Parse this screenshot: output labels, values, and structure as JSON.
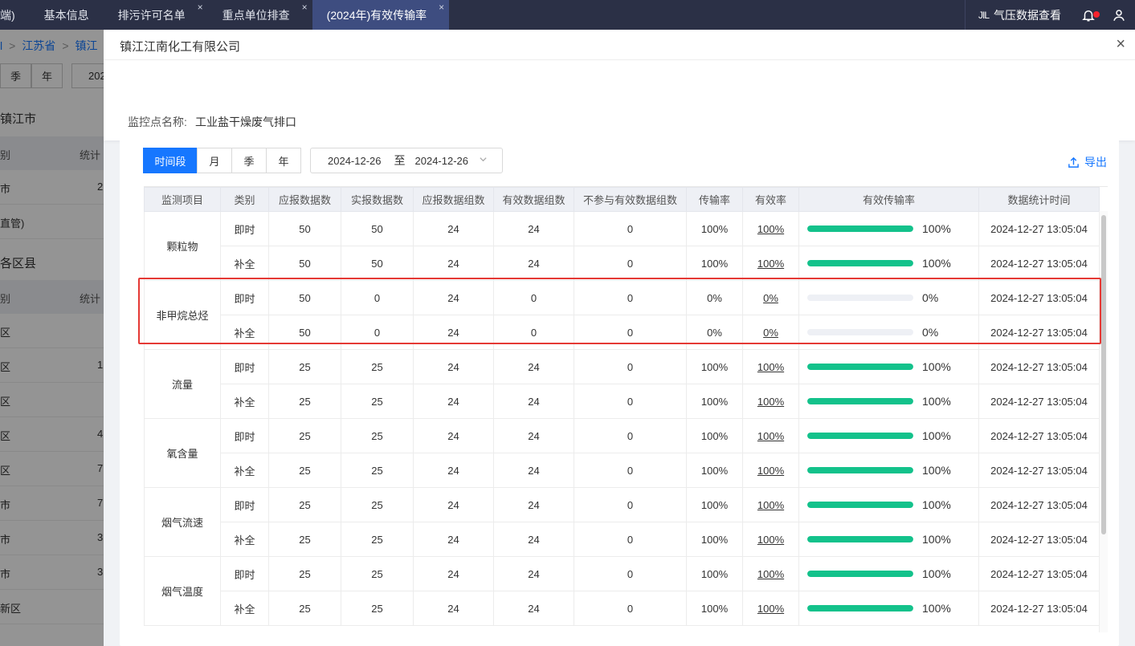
{
  "topbar": {
    "tabs": [
      {
        "label": "端)",
        "active": false,
        "closable": false
      },
      {
        "label": "基本信息",
        "active": false,
        "closable": false
      },
      {
        "label": "排污许可名单",
        "active": false,
        "closable": true
      },
      {
        "label": "重点单位排查",
        "active": false,
        "closable": true
      },
      {
        "label": "(2024年)有效传输率",
        "active": true,
        "closable": true
      }
    ],
    "close_glyph": "×",
    "pressure_icon_text": "JIL",
    "pressure_label": "气压数据查看",
    "bell_icon": "bell-icon",
    "user_icon": "user-icon"
  },
  "background": {
    "breadcrumb": [
      "l",
      ">",
      "江苏省",
      ">",
      "镇江"
    ],
    "seg": [
      "季",
      "年"
    ],
    "date": "202",
    "section1": "镇江市",
    "head1": {
      "c1": "别",
      "c2": "统计"
    },
    "rows1": [
      {
        "c1": "市",
        "c2": "2"
      },
      {
        "c1": "直管)",
        "c2": ""
      }
    ],
    "section2": "各区县",
    "head2": {
      "c1": "别",
      "c2": "统计"
    },
    "rows2": [
      {
        "c1": "区",
        "c2": ""
      },
      {
        "c1": "区",
        "c2": "1"
      },
      {
        "c1": "区",
        "c2": ""
      },
      {
        "c1": "区",
        "c2": "4"
      },
      {
        "c1": "区",
        "c2": "7"
      },
      {
        "c1": "市",
        "c2": "7"
      },
      {
        "c1": "市",
        "c2": "3"
      },
      {
        "c1": "市",
        "c2": "3"
      },
      {
        "c1": "新区",
        "c2": ""
      }
    ]
  },
  "drawer": {
    "title": "镇江江南化工有限公司",
    "close_glyph": "×",
    "monitor_label": "监控点名称:",
    "monitor_value": "工业盐干燥废气排口",
    "period_tabs": [
      {
        "label": "时间段",
        "active": true
      },
      {
        "label": "月",
        "active": false
      },
      {
        "label": "季",
        "active": false
      },
      {
        "label": "年",
        "active": false
      }
    ],
    "date_start": "2024-12-26",
    "date_sep": "至",
    "date_end": "2024-12-26",
    "export_label": "导出",
    "columns": [
      "监测项目",
      "类别",
      "应报数据数",
      "实报数据数",
      "应报数据组数",
      "有效数据组数",
      "不参与有效数据组数",
      "传输率",
      "有效率",
      "有效传输率",
      "数据统计时间"
    ],
    "groups": [
      {
        "item": "颗粒物",
        "rows": [
          {
            "type": "即时",
            "should": "50",
            "actual": "50",
            "should_groups": "24",
            "valid_groups": "24",
            "excluded": "0",
            "transmission": "100%",
            "validity": "100%",
            "effective": "100%",
            "effective_value": 100,
            "time": "2024-12-27 13:05:04"
          },
          {
            "type": "补全",
            "should": "50",
            "actual": "50",
            "should_groups": "24",
            "valid_groups": "24",
            "excluded": "0",
            "transmission": "100%",
            "validity": "100%",
            "effective": "100%",
            "effective_value": 100,
            "time": "2024-12-27 13:05:04"
          }
        ]
      },
      {
        "item": "非甲烷总烃",
        "rows": [
          {
            "type": "即时",
            "should": "50",
            "actual": "0",
            "should_groups": "24",
            "valid_groups": "0",
            "excluded": "0",
            "transmission": "0%",
            "validity": "0%",
            "effective": "0%",
            "effective_value": 0,
            "time": "2024-12-27 13:05:04"
          },
          {
            "type": "补全",
            "should": "50",
            "actual": "0",
            "should_groups": "24",
            "valid_groups": "0",
            "excluded": "0",
            "transmission": "0%",
            "validity": "0%",
            "effective": "0%",
            "effective_value": 0,
            "time": "2024-12-27 13:05:04"
          }
        ]
      },
      {
        "item": "流量",
        "rows": [
          {
            "type": "即时",
            "should": "25",
            "actual": "25",
            "should_groups": "24",
            "valid_groups": "24",
            "excluded": "0",
            "transmission": "100%",
            "validity": "100%",
            "effective": "100%",
            "effective_value": 100,
            "time": "2024-12-27 13:05:04"
          },
          {
            "type": "补全",
            "should": "25",
            "actual": "25",
            "should_groups": "24",
            "valid_groups": "24",
            "excluded": "0",
            "transmission": "100%",
            "validity": "100%",
            "effective": "100%",
            "effective_value": 100,
            "time": "2024-12-27 13:05:04"
          }
        ]
      },
      {
        "item": "氧含量",
        "rows": [
          {
            "type": "即时",
            "should": "25",
            "actual": "25",
            "should_groups": "24",
            "valid_groups": "24",
            "excluded": "0",
            "transmission": "100%",
            "validity": "100%",
            "effective": "100%",
            "effective_value": 100,
            "time": "2024-12-27 13:05:04"
          },
          {
            "type": "补全",
            "should": "25",
            "actual": "25",
            "should_groups": "24",
            "valid_groups": "24",
            "excluded": "0",
            "transmission": "100%",
            "validity": "100%",
            "effective": "100%",
            "effective_value": 100,
            "time": "2024-12-27 13:05:04"
          }
        ]
      },
      {
        "item": "烟气流速",
        "rows": [
          {
            "type": "即时",
            "should": "25",
            "actual": "25",
            "should_groups": "24",
            "valid_groups": "24",
            "excluded": "0",
            "transmission": "100%",
            "validity": "100%",
            "effective": "100%",
            "effective_value": 100,
            "time": "2024-12-27 13:05:04"
          },
          {
            "type": "补全",
            "should": "25",
            "actual": "25",
            "should_groups": "24",
            "valid_groups": "24",
            "excluded": "0",
            "transmission": "100%",
            "validity": "100%",
            "effective": "100%",
            "effective_value": 100,
            "time": "2024-12-27 13:05:04"
          }
        ]
      },
      {
        "item": "烟气温度",
        "rows": [
          {
            "type": "即时",
            "should": "25",
            "actual": "25",
            "should_groups": "24",
            "valid_groups": "24",
            "excluded": "0",
            "transmission": "100%",
            "validity": "100%",
            "effective": "100%",
            "effective_value": 100,
            "time": "2024-12-27 13:05:04"
          },
          {
            "type": "补全",
            "should": "25",
            "actual": "25",
            "should_groups": "24",
            "valid_groups": "24",
            "excluded": "0",
            "transmission": "100%",
            "validity": "100%",
            "effective": "100%",
            "effective_value": 100,
            "time": "2024-12-27 13:05:04"
          }
        ]
      }
    ],
    "colors": {
      "accent": "#1677ff",
      "bar_fill": "#13c28b",
      "bar_track": "#eef0f5",
      "highlight": "#e53935"
    }
  }
}
